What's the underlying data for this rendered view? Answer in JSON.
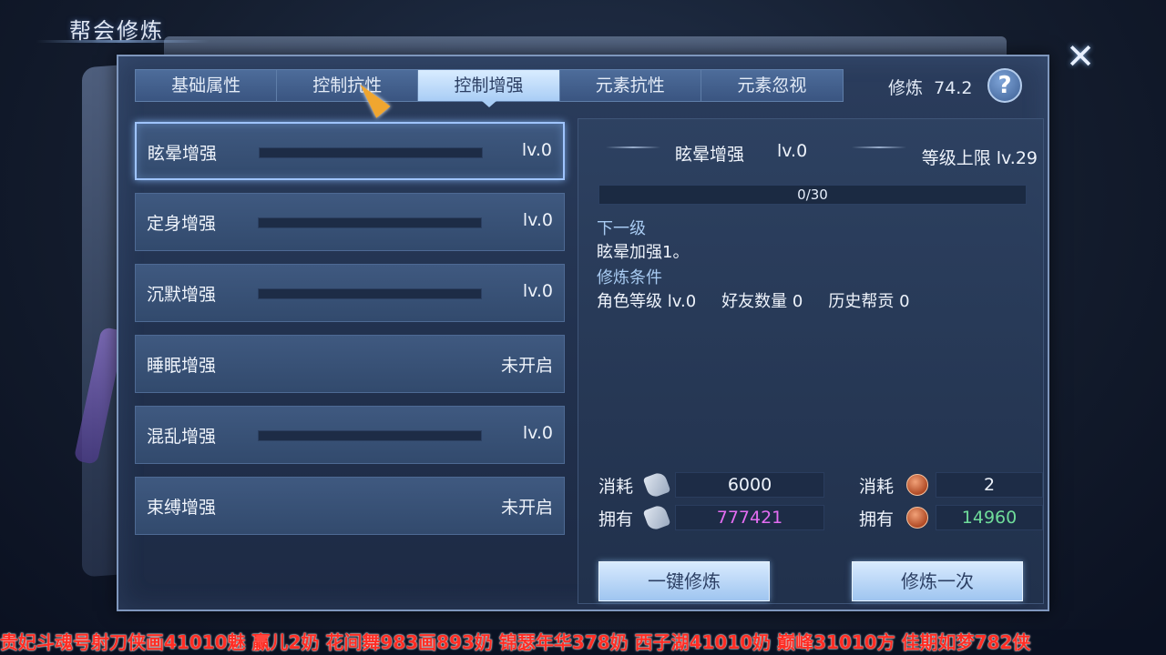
{
  "window": {
    "title": "帮会修炼"
  },
  "tabs": [
    {
      "label": "基础属性"
    },
    {
      "label": "控制抗性"
    },
    {
      "label": "控制增强"
    },
    {
      "label": "元素抗性"
    },
    {
      "label": "元素忽视"
    }
  ],
  "active_tab": "控制增强",
  "cultivation": {
    "label": "修炼",
    "value": "74.2"
  },
  "help_label": "?",
  "close_label": "✕",
  "skills": [
    {
      "name": "眩晕增强",
      "level": "lv.0",
      "progress": 0,
      "has_bar": true
    },
    {
      "name": "定身增强",
      "level": "lv.0",
      "progress": 0,
      "has_bar": true
    },
    {
      "name": "沉默增强",
      "level": "lv.0",
      "progress": 0,
      "has_bar": true
    },
    {
      "name": "睡眠增强",
      "level": "未开启",
      "has_bar": false
    },
    {
      "name": "混乱增强",
      "level": "lv.0",
      "progress": 0,
      "has_bar": true
    },
    {
      "name": "束缚增强",
      "level": "未开启",
      "has_bar": false
    }
  ],
  "detail": {
    "title": "眩晕增强",
    "level": "lv.0",
    "cap": "等级上限 lv.29",
    "progress_text": "0/30",
    "progress_fraction": 0,
    "next_label": "下一级",
    "next_desc": "眩晕加强1。",
    "cond_label": "修炼条件",
    "conditions": [
      "角色等级 lv.0",
      "好友数量 0",
      "历史帮贡 0"
    ]
  },
  "costs": {
    "consume_label": "消耗",
    "own_label": "拥有",
    "scroll_consume": "6000",
    "scroll_own": "777421",
    "coin_consume": "2",
    "coin_own": "14960",
    "scroll_own_color": "#e36df2",
    "coin_own_color": "#6fdc9a"
  },
  "buttons": {
    "one_click": "一键修炼",
    "once": "修炼一次"
  },
  "ticker": "贵妃斗魂号射刀侠画41010魅  赢儿2奶  花间舞983画893奶  锦瑟年华378奶  西子湖41010奶  巅峰31010方  佳期如梦782侠"
}
